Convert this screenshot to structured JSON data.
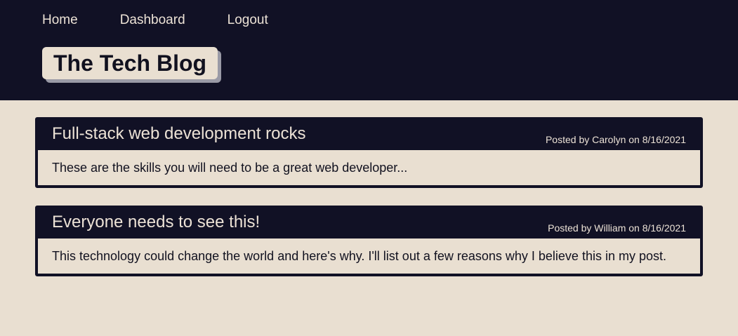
{
  "nav": {
    "home": "Home",
    "dashboard": "Dashboard",
    "logout": "Logout"
  },
  "brand": {
    "title": "The Tech Blog"
  },
  "posts": [
    {
      "title": "Full-stack web development rocks",
      "meta": "Posted by Carolyn on 8/16/2021",
      "body": "These are the skills you will need to be a great web developer..."
    },
    {
      "title": "Everyone needs to see this!",
      "meta": "Posted by William on 8/16/2021",
      "body": "This technology could change the world and here's why. I'll list out a few reasons why I believe this in my post."
    }
  ],
  "colors": {
    "header_bg": "#111125",
    "page_bg": "#e9dfd1",
    "text_light": "#ece2d6",
    "text_dark": "#11111f",
    "brand_shadow": "#9a9aa6"
  }
}
